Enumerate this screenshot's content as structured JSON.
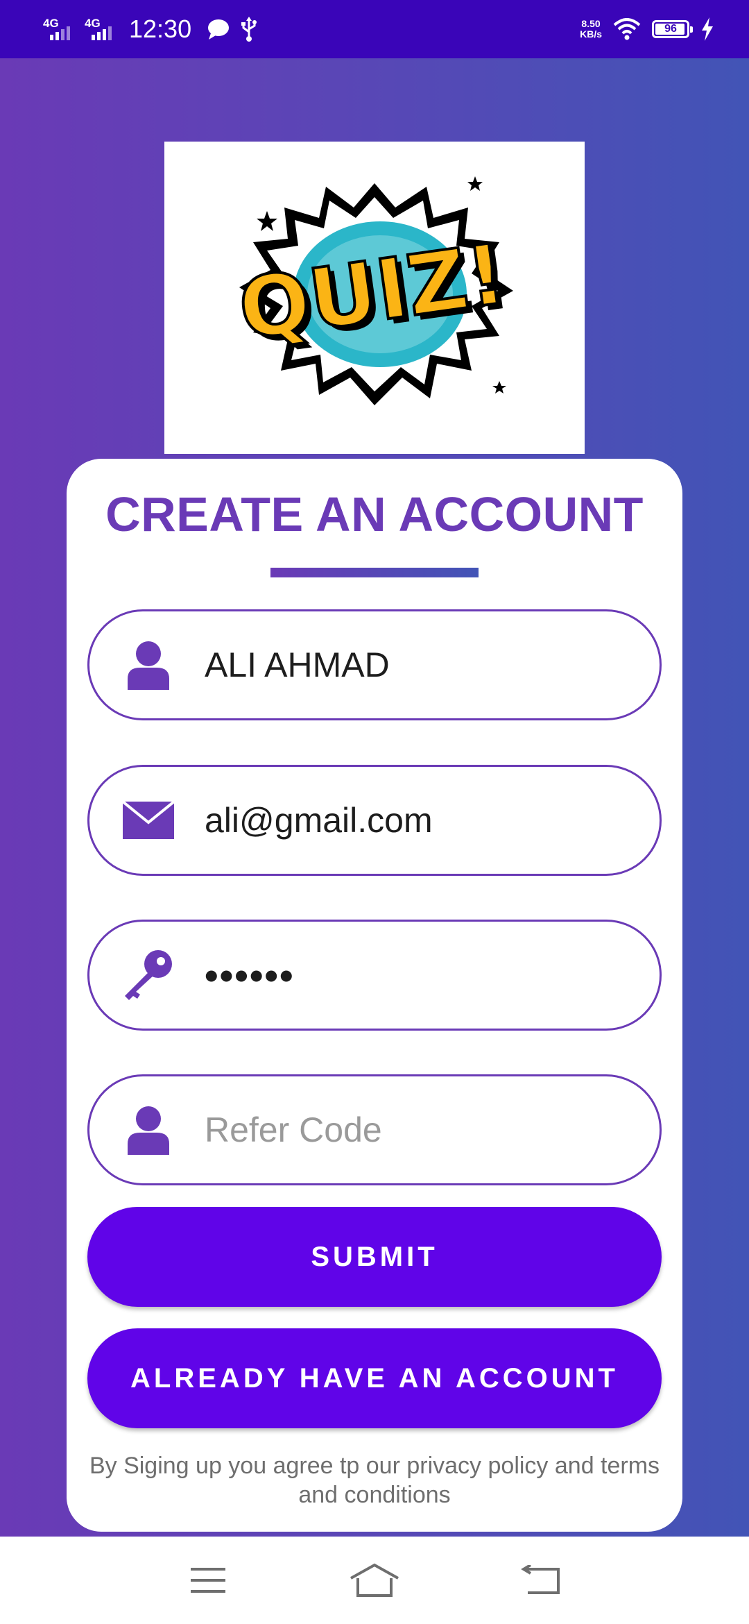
{
  "status_bar": {
    "net1": "4G",
    "net2": "4G",
    "time": "12:30",
    "speed_value": "8.50",
    "speed_unit": "KB/s",
    "battery": "96",
    "battery_level": 0.96,
    "icons": [
      "chat-bubble-icon",
      "usb-icon",
      "wifi-icon",
      "charging-bolt-icon"
    ]
  },
  "logo": {
    "text": "QUIZ!"
  },
  "form": {
    "title": "CREATE AN ACCOUNT",
    "name_value": "ALI AHMAD",
    "email_value": "ali@gmail.com",
    "password_value": "••••••",
    "refer_placeholder": "Refer Code"
  },
  "buttons": {
    "submit": "SUBMIT",
    "login": "ALREADY HAVE AN ACCOUNT"
  },
  "terms": "By Siging up you agree tp our privacy policy and terms and conditions",
  "nav": [
    "menu-icon",
    "home-icon",
    "back-icon"
  ],
  "colors": {
    "primary": "#6a3ab6",
    "button": "#6004e8",
    "status_bar": "#3a05b8"
  }
}
